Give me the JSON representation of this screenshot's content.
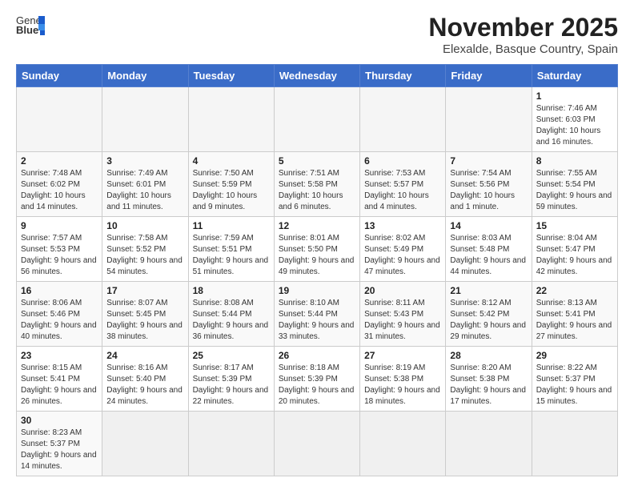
{
  "header": {
    "logo_text_normal": "General",
    "logo_text_bold": "Blue",
    "month_year": "November 2025",
    "location": "Elexalde, Basque Country, Spain"
  },
  "weekdays": [
    "Sunday",
    "Monday",
    "Tuesday",
    "Wednesday",
    "Thursday",
    "Friday",
    "Saturday"
  ],
  "weeks": [
    [
      {
        "day": "",
        "info": ""
      },
      {
        "day": "",
        "info": ""
      },
      {
        "day": "",
        "info": ""
      },
      {
        "day": "",
        "info": ""
      },
      {
        "day": "",
        "info": ""
      },
      {
        "day": "",
        "info": ""
      },
      {
        "day": "1",
        "info": "Sunrise: 7:46 AM\nSunset: 6:03 PM\nDaylight: 10 hours and 16 minutes."
      }
    ],
    [
      {
        "day": "2",
        "info": "Sunrise: 7:48 AM\nSunset: 6:02 PM\nDaylight: 10 hours and 14 minutes."
      },
      {
        "day": "3",
        "info": "Sunrise: 7:49 AM\nSunset: 6:01 PM\nDaylight: 10 hours and 11 minutes."
      },
      {
        "day": "4",
        "info": "Sunrise: 7:50 AM\nSunset: 5:59 PM\nDaylight: 10 hours and 9 minutes."
      },
      {
        "day": "5",
        "info": "Sunrise: 7:51 AM\nSunset: 5:58 PM\nDaylight: 10 hours and 6 minutes."
      },
      {
        "day": "6",
        "info": "Sunrise: 7:53 AM\nSunset: 5:57 PM\nDaylight: 10 hours and 4 minutes."
      },
      {
        "day": "7",
        "info": "Sunrise: 7:54 AM\nSunset: 5:56 PM\nDaylight: 10 hours and 1 minute."
      },
      {
        "day": "8",
        "info": "Sunrise: 7:55 AM\nSunset: 5:54 PM\nDaylight: 9 hours and 59 minutes."
      }
    ],
    [
      {
        "day": "9",
        "info": "Sunrise: 7:57 AM\nSunset: 5:53 PM\nDaylight: 9 hours and 56 minutes."
      },
      {
        "day": "10",
        "info": "Sunrise: 7:58 AM\nSunset: 5:52 PM\nDaylight: 9 hours and 54 minutes."
      },
      {
        "day": "11",
        "info": "Sunrise: 7:59 AM\nSunset: 5:51 PM\nDaylight: 9 hours and 51 minutes."
      },
      {
        "day": "12",
        "info": "Sunrise: 8:01 AM\nSunset: 5:50 PM\nDaylight: 9 hours and 49 minutes."
      },
      {
        "day": "13",
        "info": "Sunrise: 8:02 AM\nSunset: 5:49 PM\nDaylight: 9 hours and 47 minutes."
      },
      {
        "day": "14",
        "info": "Sunrise: 8:03 AM\nSunset: 5:48 PM\nDaylight: 9 hours and 44 minutes."
      },
      {
        "day": "15",
        "info": "Sunrise: 8:04 AM\nSunset: 5:47 PM\nDaylight: 9 hours and 42 minutes."
      }
    ],
    [
      {
        "day": "16",
        "info": "Sunrise: 8:06 AM\nSunset: 5:46 PM\nDaylight: 9 hours and 40 minutes."
      },
      {
        "day": "17",
        "info": "Sunrise: 8:07 AM\nSunset: 5:45 PM\nDaylight: 9 hours and 38 minutes."
      },
      {
        "day": "18",
        "info": "Sunrise: 8:08 AM\nSunset: 5:44 PM\nDaylight: 9 hours and 36 minutes."
      },
      {
        "day": "19",
        "info": "Sunrise: 8:10 AM\nSunset: 5:44 PM\nDaylight: 9 hours and 33 minutes."
      },
      {
        "day": "20",
        "info": "Sunrise: 8:11 AM\nSunset: 5:43 PM\nDaylight: 9 hours and 31 minutes."
      },
      {
        "day": "21",
        "info": "Sunrise: 8:12 AM\nSunset: 5:42 PM\nDaylight: 9 hours and 29 minutes."
      },
      {
        "day": "22",
        "info": "Sunrise: 8:13 AM\nSunset: 5:41 PM\nDaylight: 9 hours and 27 minutes."
      }
    ],
    [
      {
        "day": "23",
        "info": "Sunrise: 8:15 AM\nSunset: 5:41 PM\nDaylight: 9 hours and 26 minutes."
      },
      {
        "day": "24",
        "info": "Sunrise: 8:16 AM\nSunset: 5:40 PM\nDaylight: 9 hours and 24 minutes."
      },
      {
        "day": "25",
        "info": "Sunrise: 8:17 AM\nSunset: 5:39 PM\nDaylight: 9 hours and 22 minutes."
      },
      {
        "day": "26",
        "info": "Sunrise: 8:18 AM\nSunset: 5:39 PM\nDaylight: 9 hours and 20 minutes."
      },
      {
        "day": "27",
        "info": "Sunrise: 8:19 AM\nSunset: 5:38 PM\nDaylight: 9 hours and 18 minutes."
      },
      {
        "day": "28",
        "info": "Sunrise: 8:20 AM\nSunset: 5:38 PM\nDaylight: 9 hours and 17 minutes."
      },
      {
        "day": "29",
        "info": "Sunrise: 8:22 AM\nSunset: 5:37 PM\nDaylight: 9 hours and 15 minutes."
      }
    ],
    [
      {
        "day": "30",
        "info": "Sunrise: 8:23 AM\nSunset: 5:37 PM\nDaylight: 9 hours and 14 minutes."
      },
      {
        "day": "",
        "info": ""
      },
      {
        "day": "",
        "info": ""
      },
      {
        "day": "",
        "info": ""
      },
      {
        "day": "",
        "info": ""
      },
      {
        "day": "",
        "info": ""
      },
      {
        "day": "",
        "info": ""
      }
    ]
  ]
}
